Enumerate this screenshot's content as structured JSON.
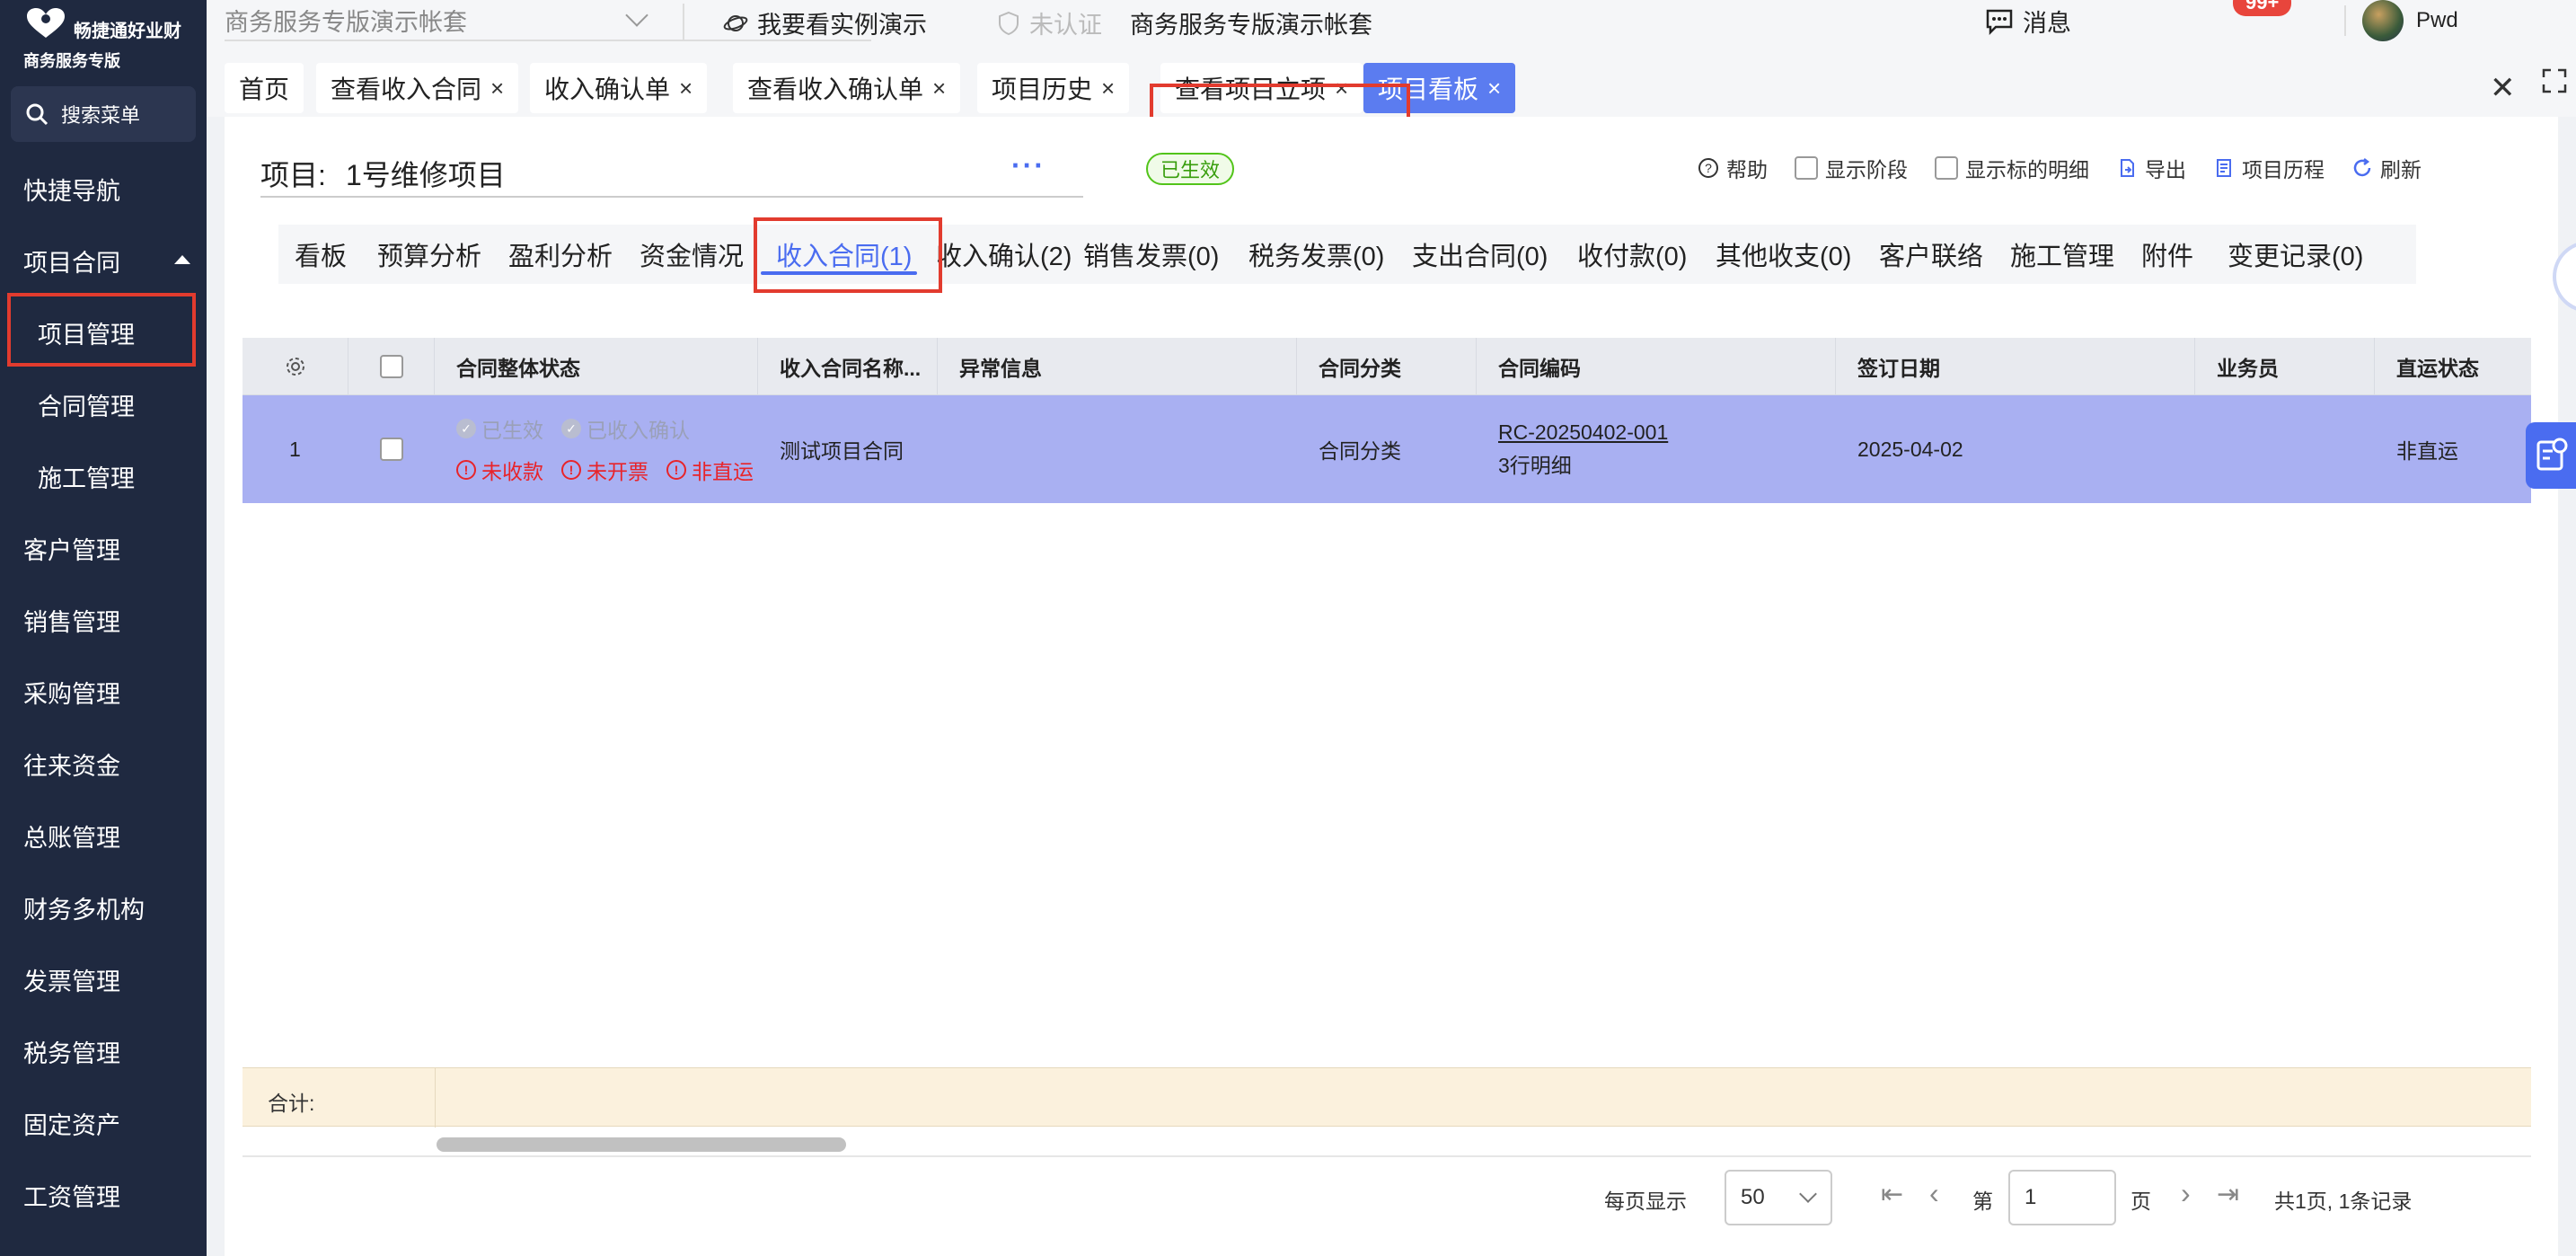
{
  "brand": {
    "title": "畅捷通好业财",
    "subtitle": "商务服务专版"
  },
  "sidebar": {
    "search_label": "搜索菜单",
    "items": [
      {
        "label": "快捷导航"
      },
      {
        "label": "项目合同"
      },
      {
        "label": "项目管理"
      },
      {
        "label": "合同管理"
      },
      {
        "label": "施工管理"
      },
      {
        "label": "客户管理"
      },
      {
        "label": "销售管理"
      },
      {
        "label": "采购管理"
      },
      {
        "label": "往来资金"
      },
      {
        "label": "总账管理"
      },
      {
        "label": "财务多机构"
      },
      {
        "label": "发票管理"
      },
      {
        "label": "税务管理"
      },
      {
        "label": "固定资产"
      },
      {
        "label": "工资管理"
      }
    ]
  },
  "topbar": {
    "account_select": "商务服务专版演示帐套",
    "demo_link": "我要看实例演示",
    "cert_status": "未认证",
    "account_name": "商务服务专版演示帐套",
    "messages_label": "消息",
    "messages_badge": "99+",
    "user_name": "Pwd"
  },
  "tabs": [
    {
      "label": "首页"
    },
    {
      "label": "查看收入合同"
    },
    {
      "label": "收入确认单"
    },
    {
      "label": "查看收入确认单"
    },
    {
      "label": "项目历史"
    },
    {
      "label": "查看项目立项"
    },
    {
      "label": "项目看板",
      "active": true
    }
  ],
  "project": {
    "label": "项目:",
    "name": "1号维修项目",
    "more": "···",
    "status": "已生效"
  },
  "toolbar": {
    "help": "帮助",
    "show_stage": "显示阶段",
    "show_detail": "显示标的明细",
    "export": "导出",
    "history": "项目历程",
    "refresh": "刷新"
  },
  "subtabs": [
    {
      "label": "看板"
    },
    {
      "label": "预算分析"
    },
    {
      "label": "盈利分析"
    },
    {
      "label": "资金情况"
    },
    {
      "label": "收入合同(1)",
      "active": true
    },
    {
      "label": "收入确认(2)"
    },
    {
      "label": "销售发票(0)"
    },
    {
      "label": "税务发票(0)"
    },
    {
      "label": "支出合同(0)"
    },
    {
      "label": "收付款(0)"
    },
    {
      "label": "其他收支(0)"
    },
    {
      "label": "客户联络"
    },
    {
      "label": "施工管理"
    },
    {
      "label": "附件"
    },
    {
      "label": "变更记录(0)"
    }
  ],
  "table": {
    "headers": {
      "status": "合同整体状态",
      "name": "收入合同名称...",
      "exception": "异常信息",
      "category": "合同分类",
      "code": "合同编码",
      "sign_date": "签订日期",
      "salesman": "业务员",
      "direct": "直运状态"
    },
    "rows": [
      {
        "index": "1",
        "status_ok": [
          "已生效",
          "已收入确认"
        ],
        "status_bad": [
          "未收款",
          "未开票",
          "非直运"
        ],
        "name": "测试项目合同",
        "exception": "",
        "category": "合同分类",
        "code": "RC-20250402-001",
        "code_detail": "3行明细",
        "sign_date": "2025-04-02",
        "salesman": "",
        "direct": "非直运"
      }
    ],
    "sum_label": "合计:"
  },
  "pager": {
    "per_page_label": "每页显示",
    "per_page": "50",
    "page_prefix": "第",
    "page": "1",
    "page_suffix": "页",
    "total": "共1页, 1条记录"
  },
  "colors": {
    "sidebar_bg": "#1f2940",
    "accent": "#4a6cf0",
    "active_tab": "#5b7cf0",
    "selected_row": "#a9b0f2",
    "highlight_box": "#e23b2e",
    "error_text": "#e8242a",
    "sum_row_bg": "#fbf1dd"
  }
}
